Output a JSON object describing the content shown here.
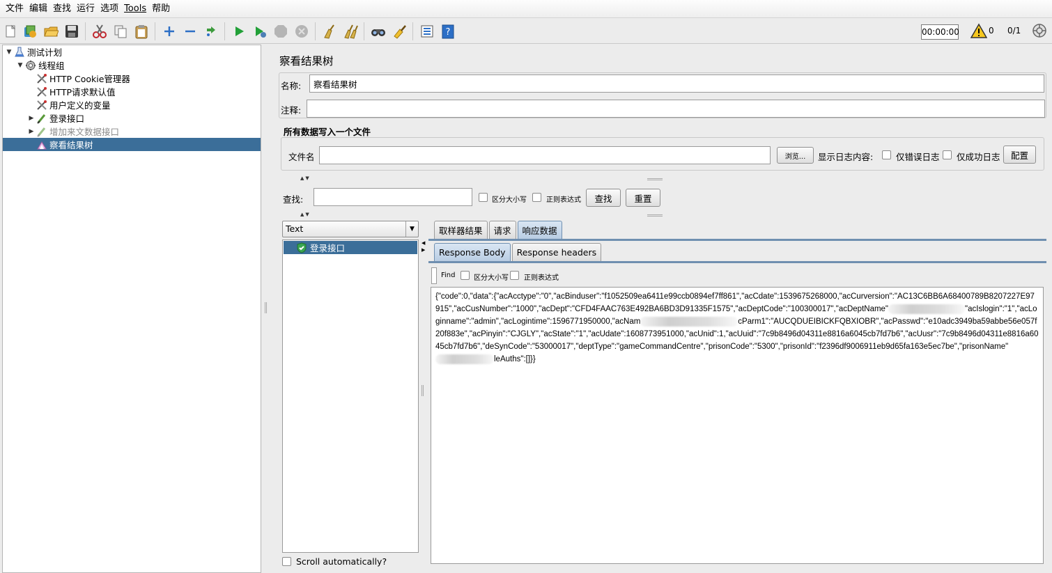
{
  "menu": [
    "文件",
    "编辑",
    "查找",
    "运行",
    "选项",
    "Tools",
    "帮助"
  ],
  "toolbar": {
    "icons": [
      "new-icon",
      "templates-icon",
      "open-icon",
      "save-icon",
      "cut-icon",
      "copy-icon",
      "paste-icon",
      "expand-icon",
      "collapse-icon",
      "toggle-icon",
      "start-icon",
      "start-no-pause-icon",
      "stop-icon",
      "shutdown-icon",
      "clear-icon",
      "clear-all-icon",
      "search-icon",
      "reset-search-icon",
      "function-helper-icon",
      "help-icon"
    ],
    "timer": "00:00:00",
    "warn_count": "0",
    "threads": "0/1"
  },
  "tree": [
    {
      "label": "测试计划",
      "icon": "test-plan-icon",
      "indent": 0,
      "toggle": "▼",
      "state": "normal"
    },
    {
      "label": "线程组",
      "icon": "thread-group-icon",
      "indent": 1,
      "toggle": "▼",
      "state": "normal"
    },
    {
      "label": "HTTP Cookie管理器",
      "icon": "config-element-icon",
      "indent": 2,
      "toggle": "",
      "state": "normal"
    },
    {
      "label": "HTTP请求默认值",
      "icon": "config-element-icon",
      "indent": 2,
      "toggle": "",
      "state": "normal"
    },
    {
      "label": "用户定义的变量",
      "icon": "config-element-icon",
      "indent": 2,
      "toggle": "",
      "state": "normal"
    },
    {
      "label": "登录接口",
      "icon": "sampler-icon",
      "indent": 2,
      "toggle": "▶",
      "state": "normal"
    },
    {
      "label": "增加来文数据接口",
      "icon": "sampler-icon",
      "indent": 2,
      "toggle": "▶",
      "state": "disabled"
    },
    {
      "label": "察看结果树",
      "icon": "listener-icon",
      "indent": 2,
      "toggle": "",
      "state": "selected"
    }
  ],
  "panel": {
    "title": "察看结果树",
    "name_label": "名称:",
    "name_value": "察看结果树",
    "comment_label": "注释:",
    "comment_value": "",
    "file_section_title": "所有数据写入一个文件",
    "filename_label": "文件名",
    "filename_value": "",
    "browse_button": "浏览...",
    "log_content_label": "显示日志内容:",
    "errors_only": "仅错误日志",
    "success_only": "仅成功日志",
    "configure_button": "配置",
    "search_label": "查找:",
    "search_value": "",
    "case_sensitive": "区分大小写",
    "regex": "正则表达式",
    "search_button": "查找",
    "reset_button": "重置"
  },
  "results": {
    "renderer": "Text",
    "items": [
      "登录接口"
    ],
    "scroll_auto": "Scroll automatically?"
  },
  "tabs": [
    "取样器结果",
    "请求",
    "响应数据"
  ],
  "active_tab": "响应数据",
  "subtabs": [
    "Response Body",
    "Response headers"
  ],
  "active_subtab": "Response Body",
  "find": {
    "label": "Find",
    "case_sensitive": "区分大小写",
    "regex": "正则表达式"
  },
  "response_body": {
    "part1": "{\"code\":0,\"data\":{\"acAcctype\":\"0\",\"acBinduser\":\"f1052509ea6411e99ccb0894ef7ff861\",\"acCdate\":1539675268000,\"acCurversion\":\"AC13C6BB6A68400789B8207227E97915\",\"acCusNumber\":\"1000\",\"acDept\":\"CFD4FAAC763E492BA6BD3D91335F1575\",\"acDeptCode\":\"100300017\",\"acDeptName\"",
    "part2": "\"acIslogin\":\"1\",\"acLoginname\":\"admin\",\"acLogintime\":1596771950000,\"acNam",
    "part3": "cParm1\":\"AUCQDUEIBICKFQBXIOBR\",\"acPasswd\":\"e10adc3949ba59abbe56e057f20f883e\",\"acPinyin\":\"CJGLY\",\"acState\":\"1\",\"acUdate\":1608773951000,\"acUnid\":1,\"acUuid\":\"7c9b8496d04311e8816a6045cb7fd7b6\",\"acUusr\":\"7c9b8496d04311e8816a6045cb7fd7b6\",\"deSynCode\":\"53000017\",\"deptType\":\"gameCommandCentre\",\"prisonCode\":\"5300\",\"prisonId\":\"f2396df9006911eb9d65fa163e5ec7be\",\"prisonName\"",
    "part4": "leAuths\":[]}}"
  },
  "colors": {
    "selection": "#3b6e99",
    "tab_active": "#b9cde3",
    "background": "#ececec"
  }
}
